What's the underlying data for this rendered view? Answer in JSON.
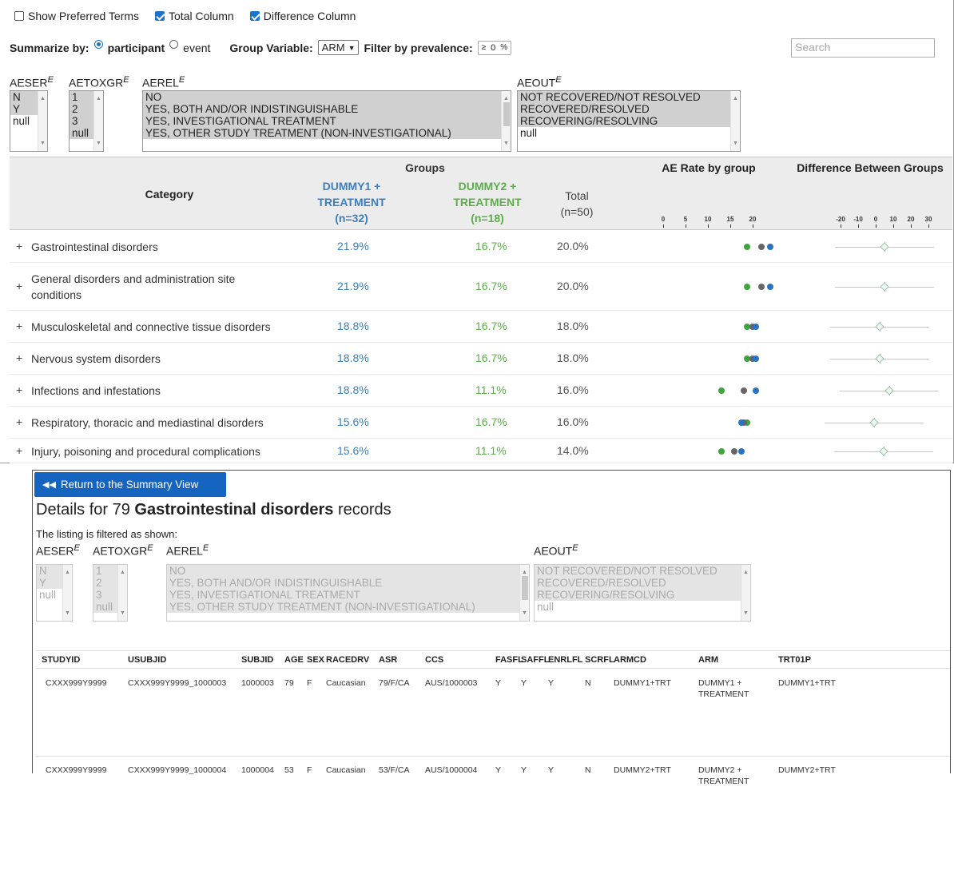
{
  "controls": {
    "show_preferred": "Show Preferred Terms",
    "total_column": "Total Column",
    "difference_column": "Difference Column"
  },
  "summarize": {
    "label": "Summarize by:",
    "opt_participant": "participant",
    "opt_event": "event",
    "group_label": "Group Variable:",
    "group_value": "ARM",
    "filter_label": "Filter by prevalence:",
    "filter_op": "≥",
    "filter_value": "0",
    "filter_unit": "%",
    "search_placeholder": "Search"
  },
  "filters": {
    "sup": "E",
    "aeser": {
      "label": "AESER",
      "options": [
        "N",
        "Y",
        "null"
      ]
    },
    "aetoxgr": {
      "label": "AETOXGR",
      "options": [
        "1",
        "2",
        "3",
        "null"
      ]
    },
    "aerel": {
      "label": "AEREL",
      "options": [
        "NO",
        "YES, BOTH AND/OR INDISTINGUISHABLE",
        "YES, INVESTIGATIONAL TREATMENT",
        "YES, OTHER STUDY TREATMENT (NON-INVESTIGATIONAL)"
      ]
    },
    "aeout": {
      "label": "AEOUT",
      "options": [
        "NOT RECOVERED/NOT RESOLVED",
        "RECOVERED/RESOLVED",
        "RECOVERING/RESOLVING",
        "null"
      ]
    }
  },
  "table": {
    "category": "Category",
    "groups": "Groups",
    "g1_line1": "DUMMY1 +",
    "g1_line2": "TREATMENT",
    "g1_n": "(n=32)",
    "g2_line1": "DUMMY2 +",
    "g2_line2": "TREATMENT",
    "g2_n": "(n=18)",
    "total": "Total",
    "total_n": "(n=50)",
    "ae_rate": "AE Rate by group",
    "diff": "Difference Between Groups",
    "rate_ticks": [
      "0",
      "5",
      "10",
      "15",
      "20"
    ],
    "diff_ticks": [
      "-20",
      "-10",
      "0",
      "10",
      "20",
      "30"
    ],
    "plus": "+",
    "rows": [
      {
        "cat": "Gastrointestinal disorders",
        "g1": "21.9%",
        "g2": "16.7%",
        "tot": "20.0%"
      },
      {
        "cat": "General disorders and administration site conditions",
        "g1": "21.9%",
        "g2": "16.7%",
        "tot": "20.0%"
      },
      {
        "cat": "Musculoskeletal and connective tissue disorders",
        "g1": "18.8%",
        "g2": "16.7%",
        "tot": "18.0%"
      },
      {
        "cat": "Nervous system disorders",
        "g1": "18.8%",
        "g2": "16.7%",
        "tot": "18.0%"
      },
      {
        "cat": "Infections and infestations",
        "g1": "18.8%",
        "g2": "11.1%",
        "tot": "16.0%"
      },
      {
        "cat": "Respiratory, thoracic and mediastinal disorders",
        "g1": "15.6%",
        "g2": "16.7%",
        "tot": "16.0%"
      },
      {
        "cat": "Injury, poisoning and procedural complications",
        "g1": "15.6%",
        "g2": "11.1%",
        "tot": "14.0%"
      }
    ]
  },
  "details": {
    "return_label": "Return to the Summary View",
    "title_prefix": "Details for 79",
    "title_bold": "Gastrointestinal disorders",
    "title_suffix": "records",
    "filtered_note": "The listing is filtered as shown:",
    "columns": [
      "STUDYID",
      "USUBJID",
      "SUBJID",
      "AGE",
      "SEX",
      "RACEDRV",
      "ASR",
      "CCS",
      "FASFL",
      "SAFFL",
      "ENRLFL",
      "SCRFL",
      "ARMCD",
      "ARM",
      "TRT01P"
    ],
    "records": [
      [
        "CXXX999Y9999",
        "CXXX999Y9999_1000003",
        "1000003",
        "79",
        "F",
        "Caucasian",
        "79/F/CA",
        "AUS/1000003",
        "Y",
        "Y",
        "Y",
        "N",
        "DUMMY1+TRT",
        "DUMMY1 + TREATMENT",
        "DUMMY1+TRT"
      ],
      [
        "CXXX999Y9999",
        "CXXX999Y9999_1000004",
        "1000004",
        "53",
        "F",
        "Caucasian",
        "53/F/CA",
        "AUS/1000004",
        "Y",
        "Y",
        "Y",
        "N",
        "DUMMY2+TRT",
        "DUMMY2 + TREATMENT",
        "DUMMY2+TRT"
      ]
    ]
  },
  "colors": {
    "group1": "#3a7fc1",
    "group2": "#5cae4a",
    "total": "#666666",
    "button": "#1565c0"
  }
}
